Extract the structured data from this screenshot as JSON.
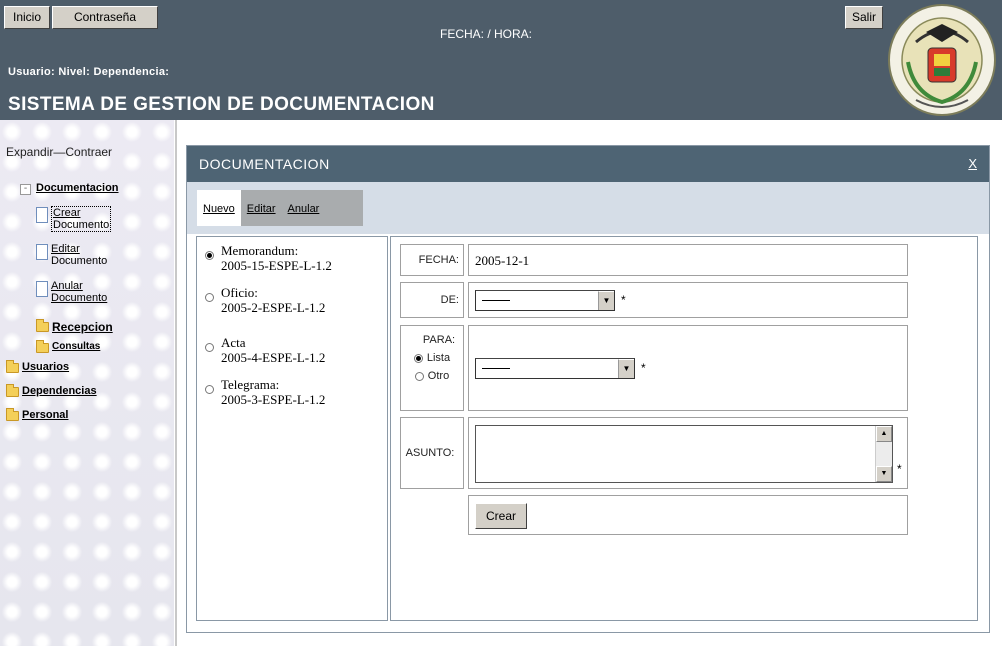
{
  "header": {
    "inicio_label": "Inicio",
    "contrasena_label": "Contraseña",
    "fecha_hora": "FECHA:  /  HORA:",
    "salir_label": "Salir",
    "user_line": "Usuario:   Nivel:   Dependencia:",
    "app_title": "SISTEMA DE GESTION DE DOCUMENTACION",
    "seal_text_top": "ESCUELA POLITECNICA DEL EJERCITO",
    "seal_text_bottom": "ECUADOR"
  },
  "sidebar": {
    "expand_label": "Expandir—Contraer",
    "documentacion": "Documentacion",
    "crear_1": "Crear",
    "crear_2": "Documento",
    "editar_1": "Editar",
    "editar_2": "Documento",
    "anular_1": "Anular",
    "anular_2": "Documento",
    "recepcion": "Recepcion",
    "consultas": "Consultas",
    "usuarios": "Usuarios",
    "dependencias": "Dependencias",
    "personal": "Personal"
  },
  "panel": {
    "title": "DOCUMENTACION",
    "close": "X",
    "tabs": {
      "nuevo": "Nuevo",
      "editar": "Editar",
      "anular": "Anular"
    }
  },
  "doc_types": [
    {
      "label": "Memorandum:",
      "code": "2005-15-ESPE-L-1.2",
      "selected": true
    },
    {
      "label": "Oficio:",
      "code": "2005-2-ESPE-L-1.2",
      "selected": false
    },
    {
      "label": "Acta",
      "code": "2005-4-ESPE-L-1.2",
      "selected": false
    },
    {
      "label": "Telegrama:",
      "code": "2005-3-ESPE-L-1.2",
      "selected": false
    }
  ],
  "form": {
    "fecha_label": "FECHA:",
    "fecha_value": "2005-12-1",
    "de_label": "DE:",
    "de_value": "",
    "para_label": "PARA:",
    "para_lista": "Lista",
    "para_otro": "Otro",
    "para_value": "",
    "asunto_label": "ASUNTO:",
    "asunto_value": "",
    "required_mark": "*",
    "crear_label": "Crear"
  },
  "colors": {
    "header_bg": "#4e5d6a",
    "panel_header_bg": "#4e6474",
    "tabs_bar_bg": "#d5dde7"
  }
}
